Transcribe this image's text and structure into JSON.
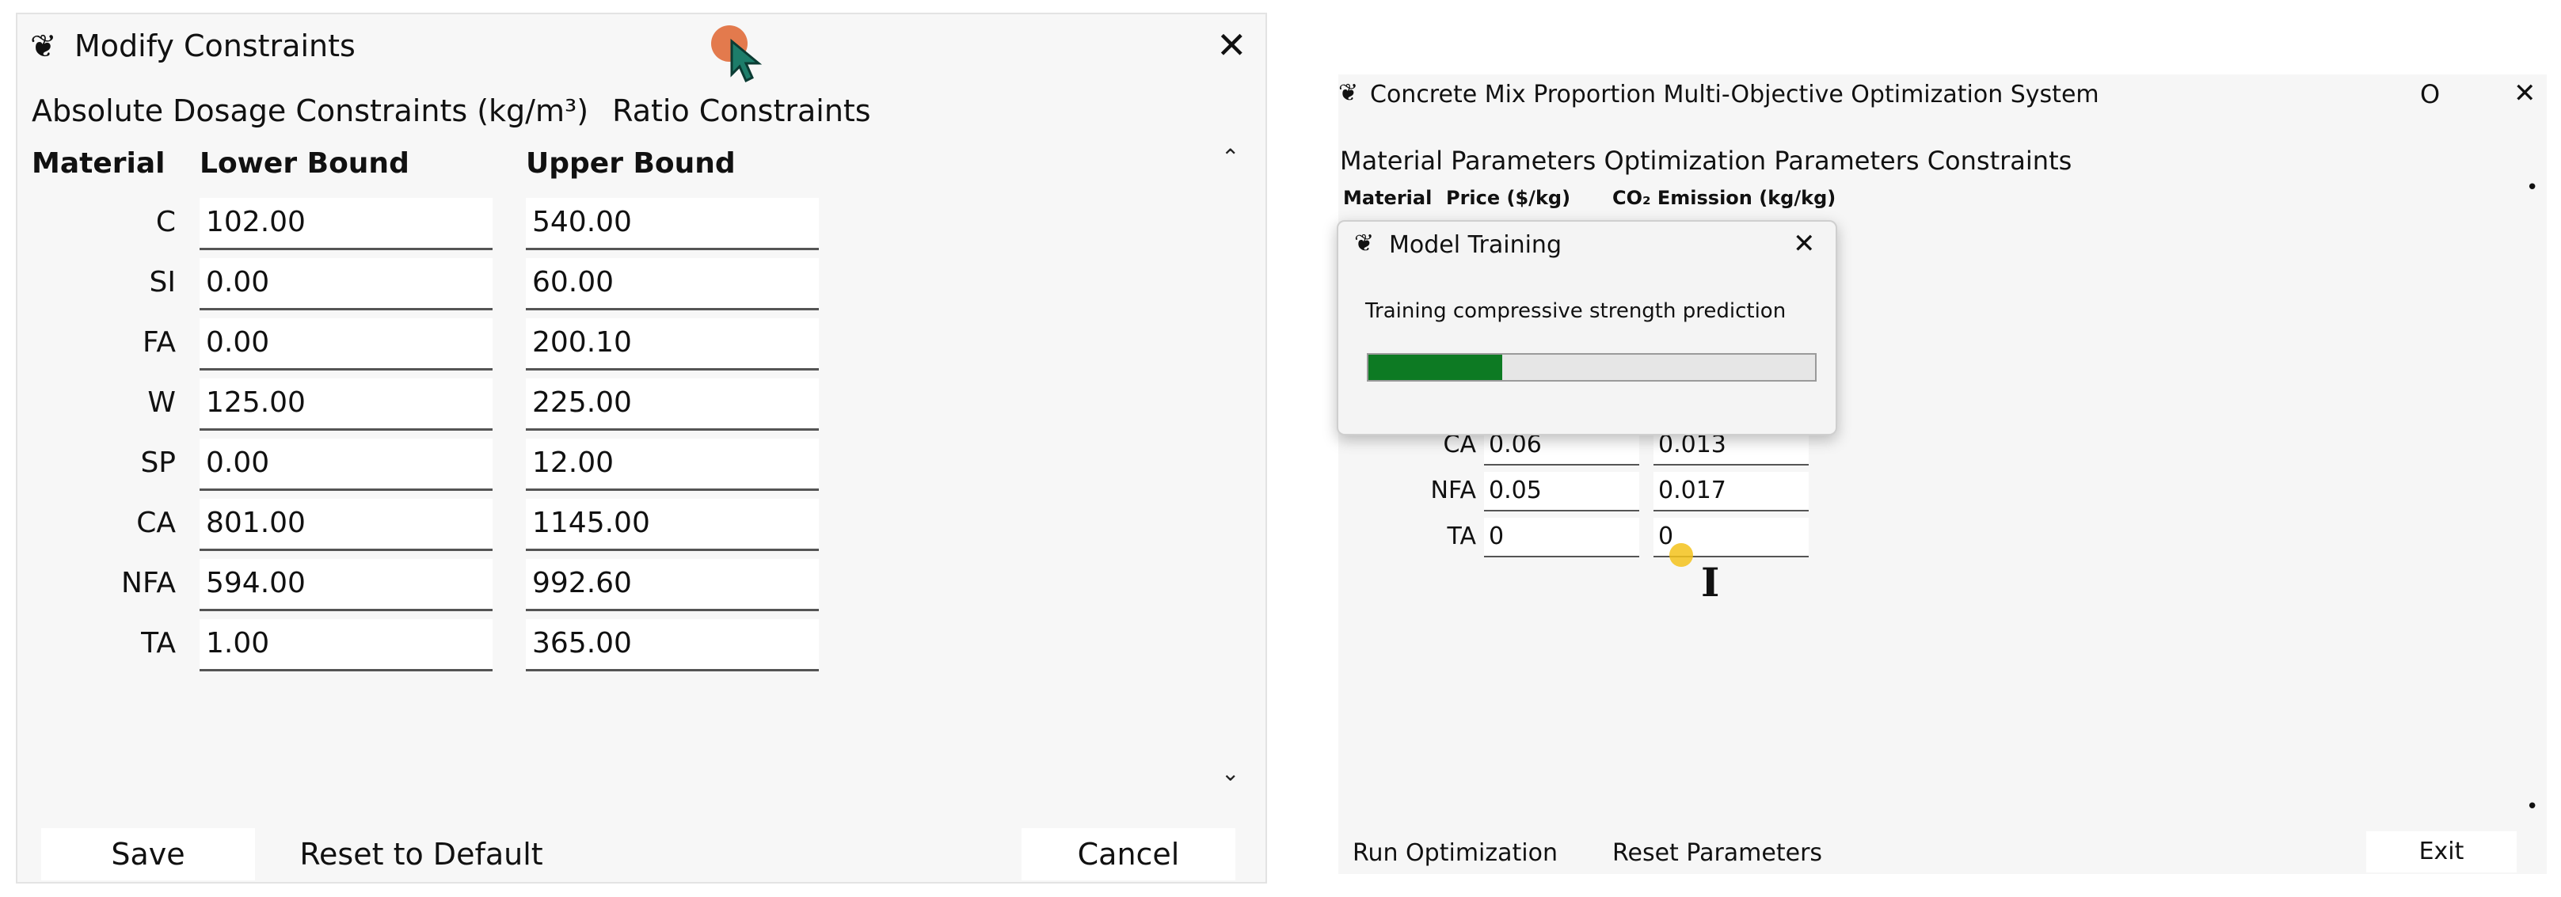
{
  "left_window": {
    "title": "Modify Constraints",
    "tabs": [
      "Absolute Dosage Constraints (kg/m³)",
      "Ratio Constraints"
    ],
    "columns": {
      "material": "Material",
      "lower": "Lower Bound",
      "upper": "Upper Bound"
    },
    "rows": [
      {
        "material": "C",
        "lower": "102.00",
        "upper": "540.00"
      },
      {
        "material": "SI",
        "lower": "0.00",
        "upper": "60.00"
      },
      {
        "material": "FA",
        "lower": "0.00",
        "upper": "200.10"
      },
      {
        "material": "W",
        "lower": "125.00",
        "upper": "225.00"
      },
      {
        "material": "SP",
        "lower": "0.00",
        "upper": "12.00"
      },
      {
        "material": "CA",
        "lower": "801.00",
        "upper": "1145.00"
      },
      {
        "material": "NFA",
        "lower": "594.00",
        "upper": "992.60"
      },
      {
        "material": "TA",
        "lower": "1.00",
        "upper": "365.00"
      }
    ],
    "buttons": {
      "save": "Save",
      "reset": "Reset to Default",
      "cancel": "Cancel"
    },
    "close_glyph": "✕"
  },
  "right_window": {
    "title": "Concrete Mix Proportion Multi-Objective Optimization System",
    "tabs": [
      "Material Parameters",
      "Optimization Parameters",
      "Constraints"
    ],
    "columns": {
      "material": "Material",
      "price": "Price ($/kg)",
      "emission": "CO₂ Emission (kg/kg)"
    },
    "rows": [
      {
        "material": "CA",
        "price": "0.06",
        "emission": "0.013"
      },
      {
        "material": "NFA",
        "price": "0.05",
        "emission": "0.017"
      },
      {
        "material": "TA",
        "price": "0",
        "emission": "0"
      }
    ],
    "buttons": {
      "run": "Run Optimization",
      "reset": "Reset Parameters",
      "exit": "Exit"
    },
    "maximize_glyph": "O",
    "close_glyph": "✕"
  },
  "dialog": {
    "title": "Model Training",
    "message": "Training compressive strength prediction",
    "progress_fraction": 0.3,
    "progress_color": "#0d7a23",
    "close_glyph": "✕"
  },
  "colors": {
    "window_bg": "#f7f7f7",
    "field_bg": "#ffffff",
    "cursor_dot": "#e06b3a",
    "click_dot": "#f3c21b"
  },
  "icons": [
    "feather-icon",
    "close-icon",
    "scroll-up-icon",
    "scroll-down-icon",
    "mouse-pointer-icon",
    "text-cursor-icon"
  ]
}
